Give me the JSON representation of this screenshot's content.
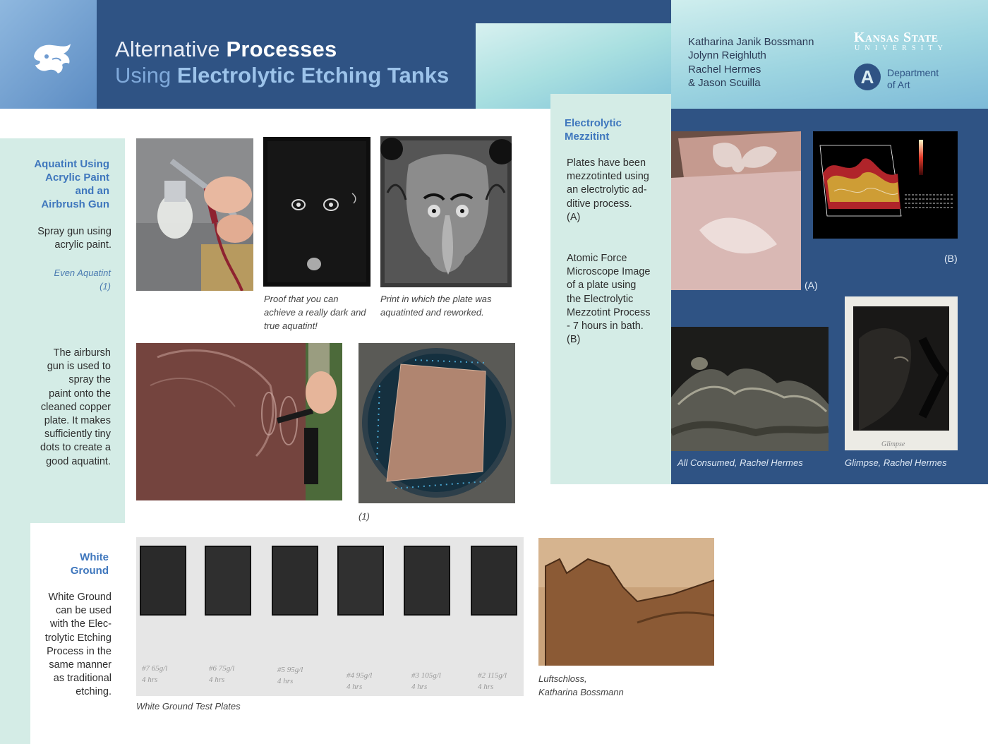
{
  "header": {
    "title_line1_light": "Alternative",
    "title_line1_bold": "Processes",
    "title_line2_light": "Using",
    "title_line2_bold": "Electrolytic Etching Tanks",
    "authors": [
      "Katharina Janik Bossmann",
      "Jolynn Reighluth",
      "Rachel Hermes",
      "& Jason Scuilla"
    ],
    "university_name": "Kansas State",
    "university_sub": "UNIVERSITY",
    "dept_mark": "A",
    "dept_line1": "Department",
    "dept_line2": "of Art",
    "logo_icon": "wildcat-logo-icon"
  },
  "aquatint": {
    "title_lines": [
      "Aquatint Using",
      "Acrylic Paint",
      "and an",
      "Airbrush Gun"
    ],
    "intro_lines": [
      "Spray gun using",
      "acrylic paint."
    ],
    "even_label": "Even Aquatint",
    "even_ref": "(1)",
    "desc_lines": [
      "The airbursh",
      "gun is used to",
      "spray the",
      "paint onto the",
      "cleaned copper",
      "plate. It makes",
      "sufficiently tiny",
      "dots to create a",
      "good aquatint."
    ],
    "caption_dark_lines": [
      "Proof that you can",
      "achieve a really dark and",
      "true aquatint!"
    ],
    "caption_reworked_lines": [
      "Print in which the plate was",
      "aquatinted and reworked."
    ],
    "caption_magnifier": "(1)"
  },
  "white_ground": {
    "title_lines": [
      "White",
      "Ground"
    ],
    "desc_lines": [
      "White Ground",
      "can be used",
      "with the Elec-",
      "trolytic Etching",
      "Process in the",
      "same manner",
      "as traditional",
      "etching."
    ],
    "test_plates_caption": "White Ground Test Plates",
    "plate_labels": [
      "#7 65g/l",
      "#6 75g/l",
      "#5 95g/l",
      "#4 95g/l",
      "#3 105g/l",
      "#2 115g/l"
    ],
    "plate_hours": [
      "4 hrs",
      "4 hrs",
      "4 hrs",
      "4 hrs",
      "4 hrs",
      "4 hrs"
    ],
    "luft_caption_lines": [
      "Luftschloss,",
      "Katharina Bossmann"
    ]
  },
  "mezzotint": {
    "title_lines": [
      "Electrolytic",
      "Mezzitint"
    ],
    "para_a_lines": [
      "Plates have been",
      "mezzotinted using",
      "an electrolytic ad-",
      "ditive process.",
      "(A)"
    ],
    "para_b_lines": [
      "Atomic Force",
      "Microscope Image",
      "of a plate using",
      "the Electrolytic",
      "Mezzotint Process",
      "- 7 hours in bath.",
      "(B)"
    ],
    "label_a": "(A)",
    "label_b": "(B)",
    "caption_consumed": "All Consumed, Rachel Hermes",
    "caption_glimpse": "Glimpse, Rachel Hermes",
    "glimpse_signature": "Glimpse"
  }
}
